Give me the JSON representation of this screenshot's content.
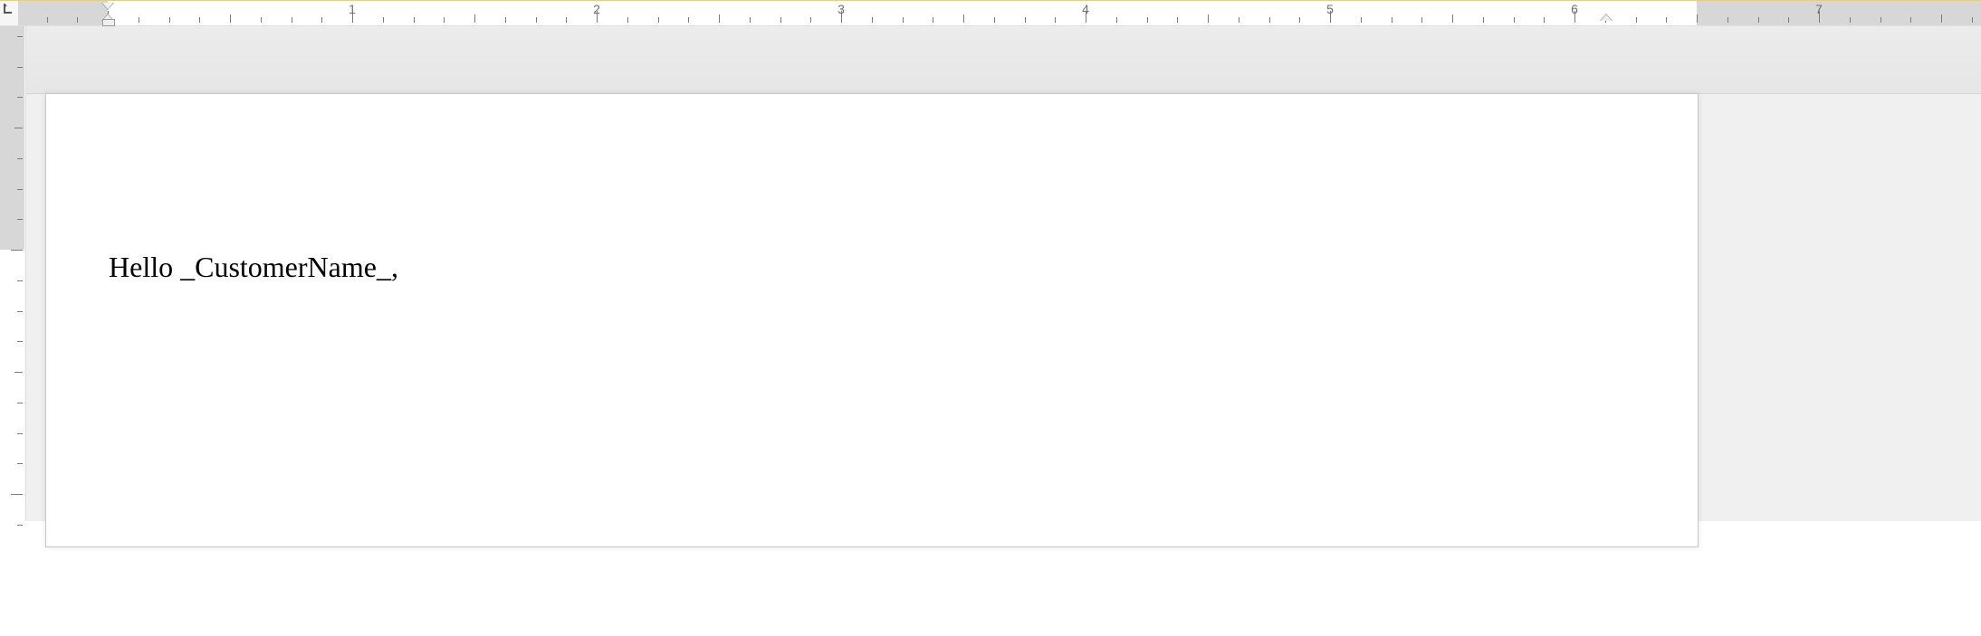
{
  "ruler": {
    "numbers": [
      "1",
      "2",
      "3",
      "4",
      "5",
      "6",
      "7"
    ],
    "tab_icon": "left-tab"
  },
  "document": {
    "body_line_1": "Hello _CustomerName_,"
  }
}
